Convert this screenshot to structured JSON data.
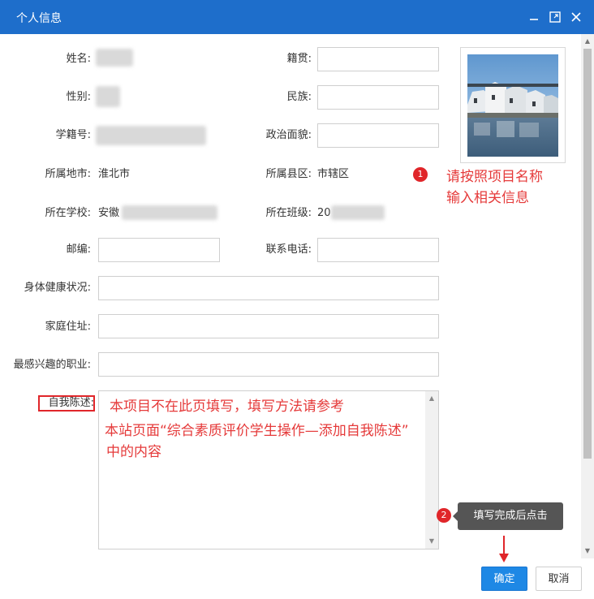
{
  "window": {
    "title": "个人信息"
  },
  "form": {
    "name_label": "姓名:",
    "native_place_label": "籍贯:",
    "gender_label": "性别:",
    "ethnicity_label": "民族:",
    "student_id_label": "学籍号:",
    "political_label": "政治面貌:",
    "city_label": "所属地市:",
    "city_value": "淮北市",
    "county_label": "所属县区:",
    "county_value": "市辖区",
    "school_label": "所在学校:",
    "school_value_prefix": "安徽",
    "class_label": "所在班级:",
    "class_value_prefix": "20",
    "postcode_label": "邮编:",
    "phone_label": "联系电话:",
    "health_label": "身体健康状况:",
    "address_label": "家庭住址:",
    "career_label": "最感兴趣的职业:",
    "self_desc_label": "自我陈述:"
  },
  "annotations": {
    "badge1": "1",
    "note1_line1": "请按照项目名称",
    "note1_line2": "输入相关信息",
    "self_line1": "本项目不在此页填写，填写方法请参考",
    "self_line2": "本站页面“综合素质评价学生操作—添加自我陈述”",
    "self_line3": "中的内容",
    "badge2": "2",
    "tooltip": "填写完成后点击"
  },
  "buttons": {
    "ok": "确定",
    "cancel": "取消"
  },
  "colors": {
    "titlebar": "#1e6ecb",
    "annotation": "#e53a3a",
    "ok_button": "#1e88e5"
  }
}
